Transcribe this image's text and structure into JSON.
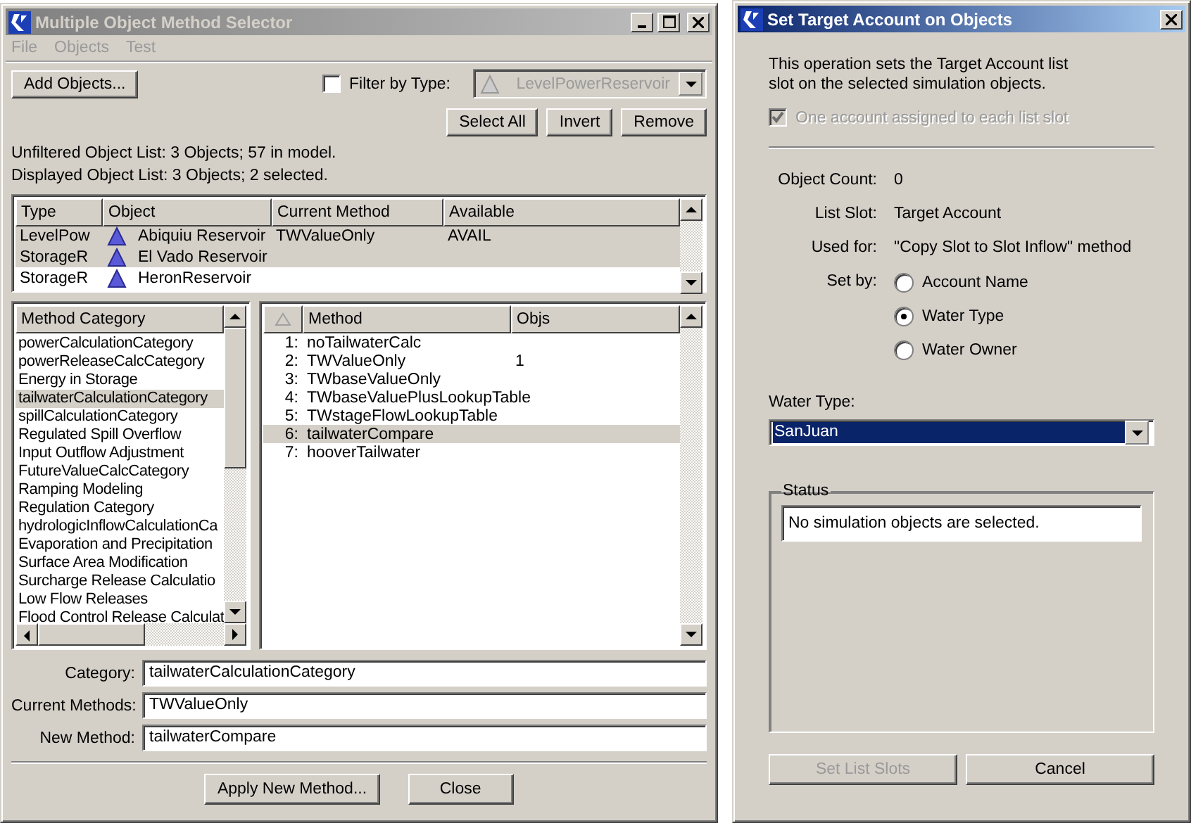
{
  "left_window": {
    "title": "Multiple Object Method Selector",
    "active": false,
    "menu": [
      {
        "label": "File",
        "disabled": true
      },
      {
        "label": "Objects",
        "disabled": true
      },
      {
        "label": "Test",
        "disabled": true
      }
    ],
    "add_button": "Add Objects...",
    "filter": {
      "label": "Filter by Type:",
      "checked": false
    },
    "type_dropdown": {
      "value": "LevelPowerReservoir",
      "disabled": true
    },
    "list_buttons": [
      "Select All",
      "Invert",
      "Remove"
    ],
    "info": [
      "Unfiltered Object List:  3 Objects;  57 in model.",
      "Displayed Object List:  3 Objects;  2 selected."
    ],
    "object_table": {
      "columns": [
        "Type",
        "Object",
        "Current Method",
        "Available"
      ],
      "rows": [
        {
          "type": "LevelPow",
          "object": "Abiquiu Reservoir",
          "current_method": "TWValueOnly",
          "available": "AVAIL",
          "selected": true
        },
        {
          "type": "StorageR",
          "object": "El Vado Reservoir",
          "selected": true
        },
        {
          "type": "StorageR",
          "object": "HeronReservoir",
          "selected": false
        }
      ]
    },
    "category_list": {
      "header": "Method Category",
      "items": [
        {
          "label": "powerCalculationCategory",
          "selected": false
        },
        {
          "label": "powerReleaseCalcCategory",
          "selected": false
        },
        {
          "label": "Energy in Storage",
          "selected": false
        },
        {
          "label": "tailwaterCalculationCategory",
          "selected": true
        },
        {
          "label": "spillCalculationCategory",
          "selected": false
        },
        {
          "label": "Regulated Spill Overflow",
          "selected": false
        },
        {
          "label": "Input Outflow Adjustment",
          "selected": false
        },
        {
          "label": "FutureValueCalcCategory",
          "selected": false
        },
        {
          "label": "Ramping Modeling",
          "selected": false
        },
        {
          "label": "Regulation Category",
          "selected": false
        },
        {
          "label": "hydrologicInflowCalculationCa",
          "selected": false
        },
        {
          "label": "Evaporation and Precipitation",
          "selected": false
        },
        {
          "label": "Surface Area Modification",
          "selected": false
        },
        {
          "label": "Surcharge Release Calculatio",
          "selected": false
        },
        {
          "label": "Low Flow Releases",
          "selected": false
        },
        {
          "label": "Flood Control Release Calculat",
          "selected": false
        }
      ]
    },
    "method_table": {
      "columns": [
        "Method",
        "Objs"
      ],
      "rows": [
        {
          "number": "1:",
          "method": "noTailwaterCalc",
          "selected": false
        },
        {
          "number": "2:",
          "method": "TWValueOnly",
          "objs": "1",
          "selected": false
        },
        {
          "number": "3:",
          "method": "TWbaseValueOnly",
          "selected": false
        },
        {
          "number": "4:",
          "method": "TWbaseValuePlusLookupTable",
          "selected": false
        },
        {
          "number": "5:",
          "method": "TWstageFlowLookupTable",
          "selected": false
        },
        {
          "number": "6:",
          "method": "tailwaterCompare",
          "selected": true
        },
        {
          "number": "7:",
          "method": "hooverTailwater",
          "selected": false
        }
      ]
    },
    "fields": [
      {
        "label": "Category:",
        "value": "tailwaterCalculationCategory"
      },
      {
        "label": "Current Methods:",
        "value": "TWValueOnly"
      },
      {
        "label": "New Method:",
        "value": "tailwaterCompare"
      }
    ],
    "buttons": [
      "Apply New Method...",
      "Close"
    ]
  },
  "right_window": {
    "title": "Set Target Account on Objects",
    "active": true,
    "description": "This operation sets the Target Account list slot on the selected simulation objects.",
    "one_account": {
      "label": "One account assigned to each list slot",
      "checked": true,
      "disabled": true
    },
    "details": [
      {
        "label": "Object Count:",
        "value": "0"
      },
      {
        "label": "List Slot:",
        "value": "Target Account"
      },
      {
        "label": "Used for:",
        "value": "\"Copy Slot to Slot Inflow\" method"
      }
    ],
    "set_by": {
      "label": "Set by:",
      "options": [
        {
          "label": "Account Name",
          "selected": false
        },
        {
          "label": "Water Type",
          "selected": true
        },
        {
          "label": "Water Owner",
          "selected": false
        }
      ]
    },
    "water_type": {
      "label": "Water Type:",
      "value": "SanJuan"
    },
    "status": {
      "title": "Status",
      "text": "No simulation objects are selected."
    },
    "buttons": [
      {
        "label": "Set List Slots",
        "disabled": true
      },
      {
        "label": "Cancel",
        "disabled": false
      }
    ]
  }
}
